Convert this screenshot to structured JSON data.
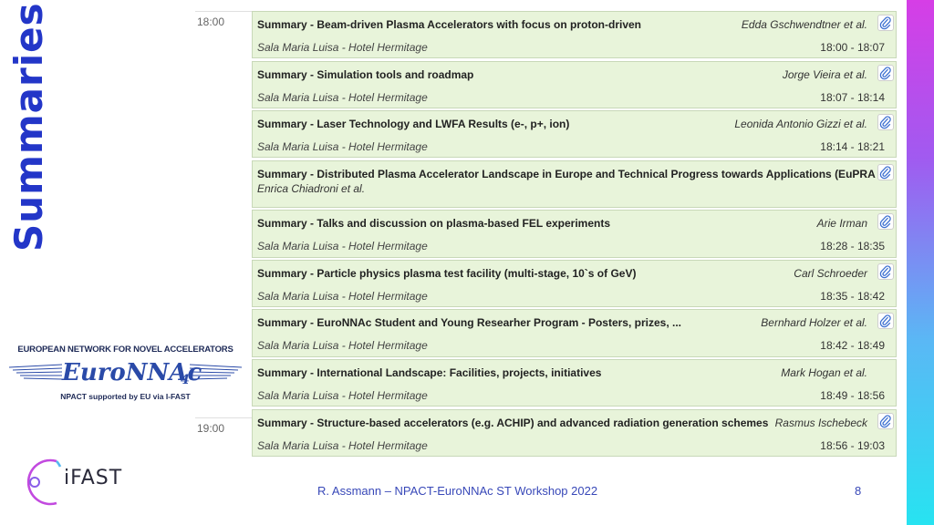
{
  "slide": {
    "title": "Summaries",
    "footer": "R. Assmann – NPACT-EuroNNAc ST Workshop 2022",
    "page_number": "8",
    "accent_color": "#2336c8"
  },
  "logos": {
    "euronnac": {
      "top_text": "EUROPEAN NETWORK FOR NOVEL ACCELERATORS",
      "name": "EuroNNAc",
      "subscript": "4",
      "bottom_text": "NPACT supported by EU via I-FAST"
    },
    "ifast": {
      "name": "iFAST"
    }
  },
  "timeline": {
    "times": [
      "18:00",
      "19:00"
    ]
  },
  "entries": [
    {
      "title": "Summary - Beam-driven Plasma Accelerators with focus on proton-driven",
      "author": "Edda Gschwendtner et al.",
      "room": "Sala Maria Luisa - Hotel Hermitage",
      "time": "18:00 - 18:07"
    },
    {
      "title": "Summary - Simulation tools and roadmap",
      "author": "Jorge Vieira et al.",
      "room": "Sala Maria Luisa - Hotel Hermitage",
      "time": "18:07 - 18:14"
    },
    {
      "title": "Summary - Laser Technology and LWFA Results (e-, p+, ion)",
      "author": "Leonida Antonio Gizzi et al.",
      "room": "Sala Maria Luisa - Hotel Hermitage",
      "time": "18:14 - 18:21"
    },
    {
      "title": "Summary - Distributed Plasma Accelerator Landscape in Europe and Technical Progress towards Applications (EuPRA",
      "author": "Enrica Chiadroni et al.",
      "room": "",
      "time": ""
    },
    {
      "title": "Summary - Talks and discussion on plasma-based FEL experiments",
      "author": "Arie Irman",
      "room": "Sala Maria Luisa - Hotel Hermitage",
      "time": "18:28 - 18:35"
    },
    {
      "title": "Summary - Particle physics plasma test facility (multi-stage, 10`s of GeV)",
      "author": "Carl Schroeder",
      "room": "Sala Maria Luisa - Hotel Hermitage",
      "time": "18:35 - 18:42"
    },
    {
      "title": "Summary - EuroNNAc Student and Young Researher Program - Posters, prizes, ...",
      "author": "Bernhard Holzer et al.",
      "room": "Sala Maria Luisa - Hotel Hermitage",
      "time": "18:42 - 18:49"
    },
    {
      "title": "Summary - International Landscape: Facilities, projects, initiatives",
      "author": "Mark Hogan et al.",
      "room": "Sala Maria Luisa - Hotel Hermitage",
      "time": "18:49 - 18:56"
    },
    {
      "title": "Summary - Structure-based accelerators (e.g. ACHIP) and advanced radiation generation schemes",
      "author": "Rasmus Ischebeck",
      "room": "Sala Maria Luisa - Hotel Hermitage",
      "time": "18:56 - 19:03"
    }
  ]
}
